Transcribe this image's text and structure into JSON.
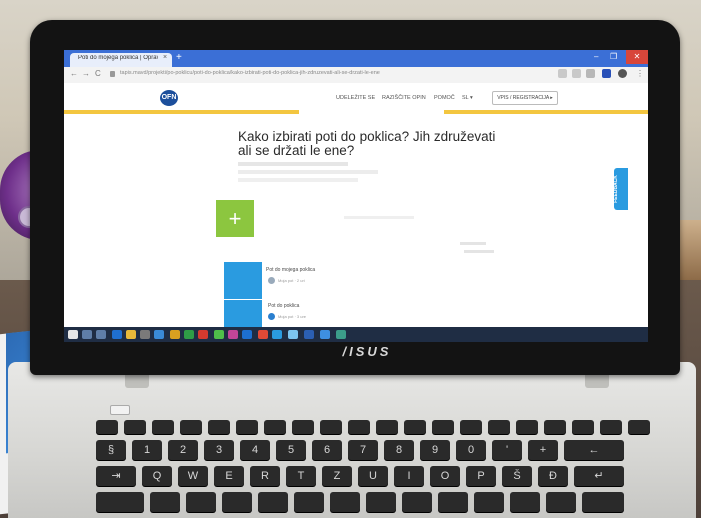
{
  "browser": {
    "tab_title": "Poti do mojega poklica | Opravi",
    "tab_close": "×",
    "new_tab": "+",
    "url": "tapis.mavd/projekti/po-poklicu/poti-do-poklica/kako-izbirati-poti-do-poklica-jih-zdruzevati-ali-se-drzati-le-ene",
    "nav_back": "←",
    "nav_forward": "→",
    "nav_reload": "C",
    "window_min": "–",
    "window_max": "❐",
    "window_close": "✕"
  },
  "site": {
    "logo_text": "OFN",
    "nav": [
      "UDELEŽITE SE",
      "RAZIŠČITE OPIN",
      "POMOČ",
      "SL ▾"
    ],
    "cta": "VPIS / REGISTRACIJA ▸",
    "headline_line1": "Kako izbirati poti do poklica? Jih združevati",
    "headline_line2": "ali se držati le ene?",
    "feedback": "FEEDBACK",
    "rows": [
      {
        "title": "Pot do mojega poklica",
        "sub": "Moja pot · 2 uri"
      },
      {
        "title": "Pot do poklica",
        "sub": "Moja pot · 3 ure"
      }
    ],
    "add_symbol": "+"
  },
  "laptop": {
    "brand": "/ISUS"
  },
  "keyboard": {
    "row2": [
      "§",
      "1",
      "2",
      "3",
      "4",
      "5",
      "6",
      "7",
      "8",
      "9",
      "0",
      "'",
      "+",
      "←"
    ],
    "row3": [
      "⇥",
      "Q",
      "W",
      "E",
      "R",
      "T",
      "Z",
      "U",
      "I",
      "O",
      "P",
      "Š",
      "Đ",
      "↵"
    ]
  },
  "colors": {
    "accent_yellow": "#f3c640",
    "tile_blue": "#2a9be0",
    "add_green": "#8cc63f",
    "chrome_blue": "#3b6fd6"
  }
}
